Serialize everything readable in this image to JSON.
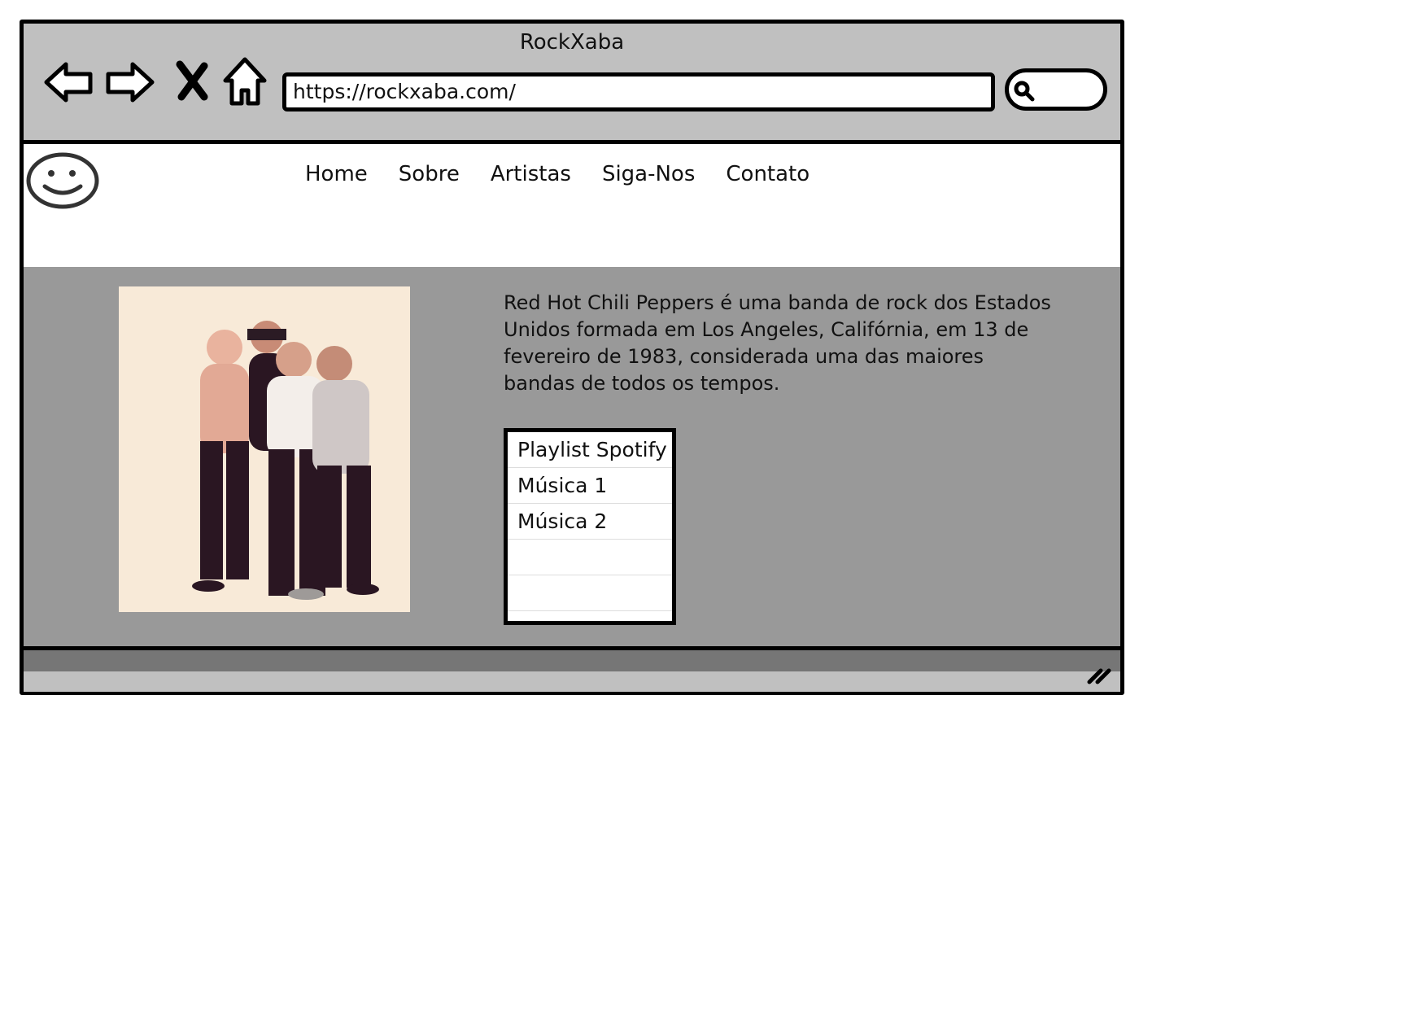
{
  "window": {
    "title": "RockXaba"
  },
  "toolbar": {
    "back_icon": "back-arrow-icon",
    "forward_icon": "forward-arrow-icon",
    "stop_icon": "close-x-icon",
    "home_icon": "home-icon",
    "url": "https://rockxaba.com/",
    "search_icon": "search-icon"
  },
  "site": {
    "logo_icon": "smiley-face-icon",
    "menu": [
      {
        "label": "Home"
      },
      {
        "label": "Sobre"
      },
      {
        "label": "Artistas"
      },
      {
        "label": "Siga-Nos"
      },
      {
        "label": "Contato"
      }
    ]
  },
  "main": {
    "photo_icon": "band-photo-image",
    "description": "Red Hot Chili Peppers é uma banda de rock dos Estados Unidos formada em Los Angeles, Califórnia, em 13 de fevereiro de 1983, considerada uma das maiores bandas de todos os tempos.",
    "playlist": {
      "header": "Playlist Spotify",
      "items": [
        "Música 1",
        "Música 2",
        "",
        ""
      ]
    }
  },
  "colors": {
    "chrome": "#c0c0c0",
    "content_bg": "#999999",
    "status_dark": "#767676"
  }
}
